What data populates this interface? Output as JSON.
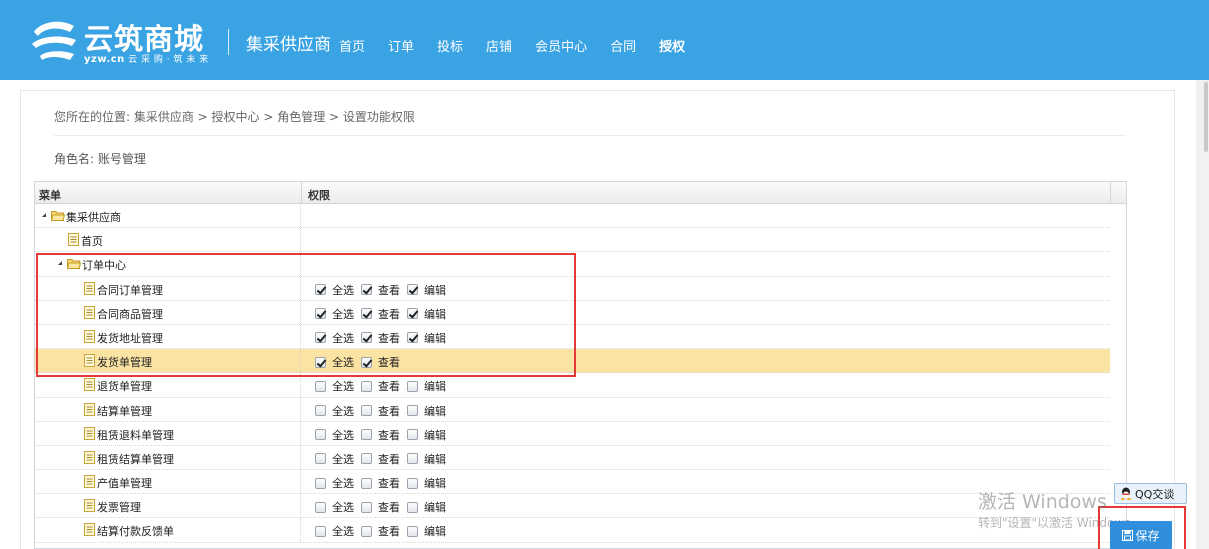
{
  "header": {
    "logo_text": "云筑商城",
    "logo_sub_brand": "yzw.cn",
    "logo_sub_tagline": "云 采 购 · 筑 未 来",
    "brand_sub": "集采供应商",
    "nav": [
      {
        "label": "首页",
        "active": false
      },
      {
        "label": "订单",
        "active": false
      },
      {
        "label": "投标",
        "active": false
      },
      {
        "label": "店铺",
        "active": false
      },
      {
        "label": "会员中心",
        "active": false
      },
      {
        "label": "合同",
        "active": false
      },
      {
        "label": "授权",
        "active": true
      }
    ]
  },
  "breadcrumb": "您所在的位置:  集采供应商 > 授权中心 > 角色管理 > 设置功能权限",
  "role": {
    "label": "角色名:",
    "value": "账号管理"
  },
  "grid": {
    "columns": {
      "menu": "菜单",
      "perm": "权限"
    },
    "rows": [
      {
        "label": "集采供应商",
        "type": "folder",
        "level": 0,
        "expanded": true,
        "perms": []
      },
      {
        "label": "首页",
        "type": "doc",
        "level": 1,
        "perms": []
      },
      {
        "label": "订单中心",
        "type": "folder",
        "level": 1,
        "expanded": true,
        "perms": []
      },
      {
        "label": "合同订单管理",
        "type": "doc",
        "level": 2,
        "perms": [
          {
            "label": "全选",
            "checked": true
          },
          {
            "label": "查看",
            "checked": true
          },
          {
            "label": "编辑",
            "checked": true
          }
        ]
      },
      {
        "label": "合同商品管理",
        "type": "doc",
        "level": 2,
        "perms": [
          {
            "label": "全选",
            "checked": true
          },
          {
            "label": "查看",
            "checked": true
          },
          {
            "label": "编辑",
            "checked": true
          }
        ]
      },
      {
        "label": "发货地址管理",
        "type": "doc",
        "level": 2,
        "perms": [
          {
            "label": "全选",
            "checked": true
          },
          {
            "label": "查看",
            "checked": true
          },
          {
            "label": "编辑",
            "checked": true
          }
        ]
      },
      {
        "label": "发货单管理",
        "type": "doc",
        "level": 2,
        "selected": true,
        "perms": [
          {
            "label": "全选",
            "checked": true
          },
          {
            "label": "查看",
            "checked": true
          }
        ]
      },
      {
        "label": "退货单管理",
        "type": "doc",
        "level": 2,
        "perms": [
          {
            "label": "全选",
            "checked": false
          },
          {
            "label": "查看",
            "checked": false
          },
          {
            "label": "编辑",
            "checked": false
          }
        ]
      },
      {
        "label": "结算单管理",
        "type": "doc",
        "level": 2,
        "perms": [
          {
            "label": "全选",
            "checked": false
          },
          {
            "label": "查看",
            "checked": false
          },
          {
            "label": "编辑",
            "checked": false
          }
        ]
      },
      {
        "label": "租赁退料单管理",
        "type": "doc",
        "level": 2,
        "perms": [
          {
            "label": "全选",
            "checked": false
          },
          {
            "label": "查看",
            "checked": false
          },
          {
            "label": "编辑",
            "checked": false
          }
        ]
      },
      {
        "label": "租赁结算单管理",
        "type": "doc",
        "level": 2,
        "perms": [
          {
            "label": "全选",
            "checked": false
          },
          {
            "label": "查看",
            "checked": false
          },
          {
            "label": "编辑",
            "checked": false
          }
        ]
      },
      {
        "label": "产值单管理",
        "type": "doc",
        "level": 2,
        "perms": [
          {
            "label": "全选",
            "checked": false
          },
          {
            "label": "查看",
            "checked": false
          },
          {
            "label": "编辑",
            "checked": false
          }
        ]
      },
      {
        "label": "发票管理",
        "type": "doc",
        "level": 2,
        "perms": [
          {
            "label": "全选",
            "checked": false
          },
          {
            "label": "查看",
            "checked": false
          },
          {
            "label": "编辑",
            "checked": false
          }
        ]
      },
      {
        "label": "结算付款反馈单",
        "type": "doc",
        "level": 2,
        "perms": [
          {
            "label": "全选",
            "checked": false
          },
          {
            "label": "查看",
            "checked": false
          },
          {
            "label": "编辑",
            "checked": false
          }
        ]
      }
    ]
  },
  "watermark": {
    "line1": "激活 Windows",
    "line2": "转到\"设置\"以激活 Windows。"
  },
  "qq": {
    "label": "QQ交谈"
  },
  "save": {
    "label": "保存"
  },
  "colors": {
    "header_bg": "#3aa3e4",
    "selected_row": "#fbe3a4",
    "highlight": "#e53935",
    "save_bg": "#2f8fdc"
  }
}
